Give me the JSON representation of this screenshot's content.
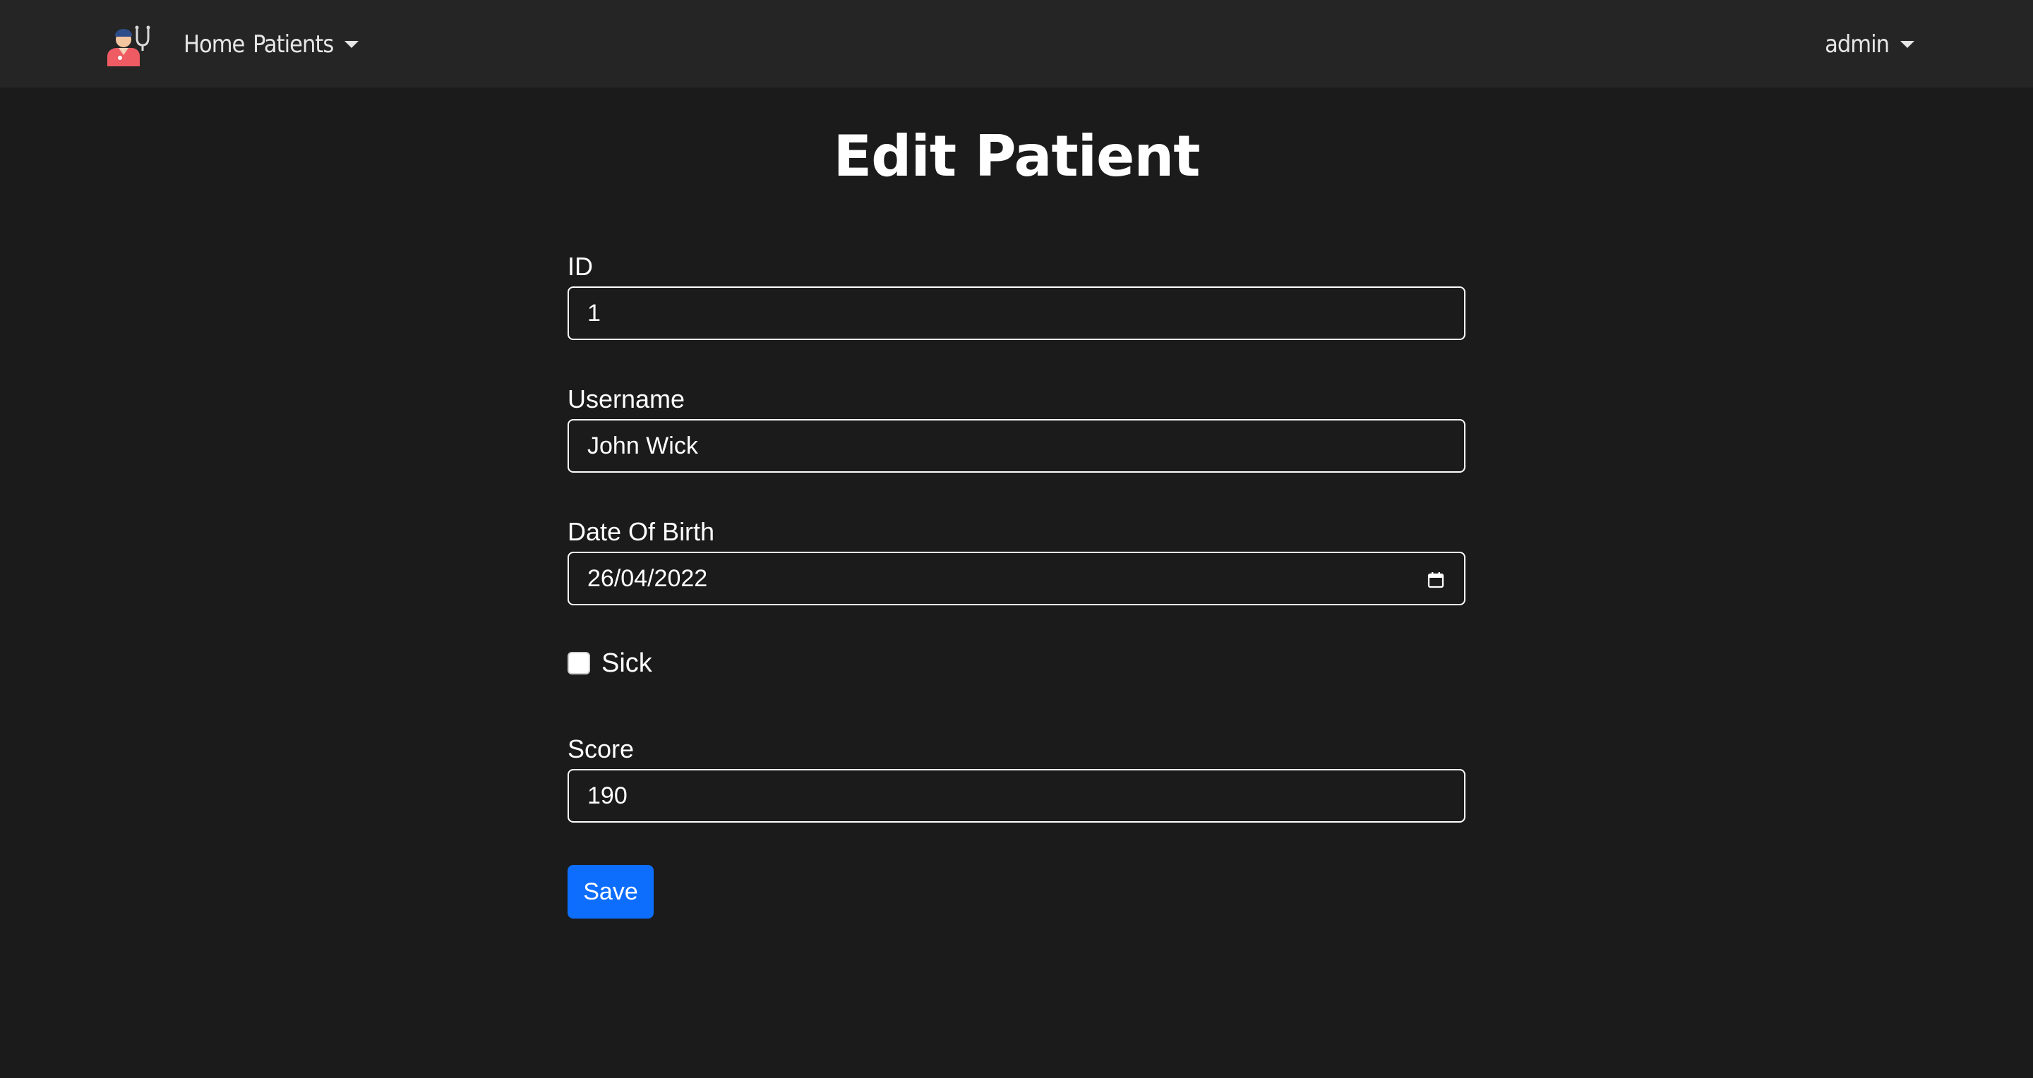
{
  "navbar": {
    "logo_icon": "doctor-with-stethoscope",
    "home_label": "Home",
    "patients_label": "Patients",
    "user_label": "admin"
  },
  "page": {
    "title": "Edit Patient"
  },
  "form": {
    "id": {
      "label": "ID",
      "value": "1"
    },
    "username": {
      "label": "Username",
      "value": "John Wick"
    },
    "dob": {
      "label": "Date Of Birth",
      "value": "26/04/2022"
    },
    "sick": {
      "label": "Sick",
      "checked": false
    },
    "score": {
      "label": "Score",
      "value": "190"
    },
    "save_label": "Save"
  },
  "colors": {
    "background": "#1b1b1b",
    "navbar": "#252525",
    "accent": "#0d6efd"
  }
}
